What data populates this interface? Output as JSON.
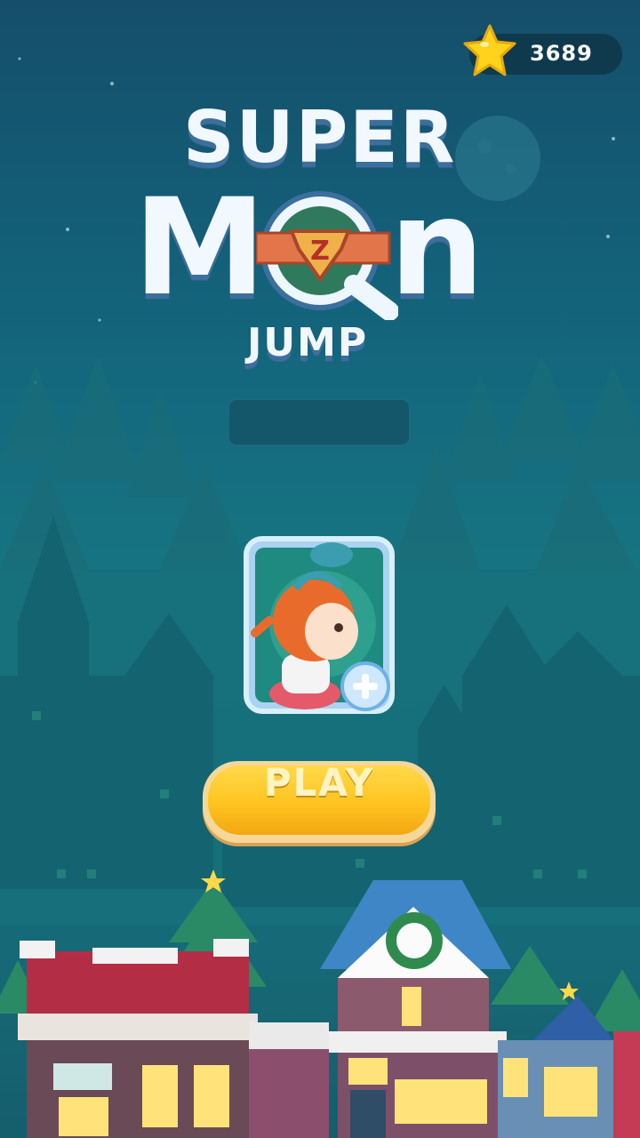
{
  "coins": {
    "count": "3689",
    "icon": "star-icon",
    "color": "#ffd21c"
  },
  "title": {
    "line1": "SUPER",
    "m": "M",
    "n": "n",
    "line3": "JUMP",
    "emblem_letter": "Z"
  },
  "name_field": {
    "value": ""
  },
  "avatar": {
    "add_icon": "plus-icon"
  },
  "play": {
    "label": "PLAY"
  },
  "colors": {
    "background": "#167482",
    "play_button": "#ffc420",
    "title_text": "#f1f8ff"
  }
}
